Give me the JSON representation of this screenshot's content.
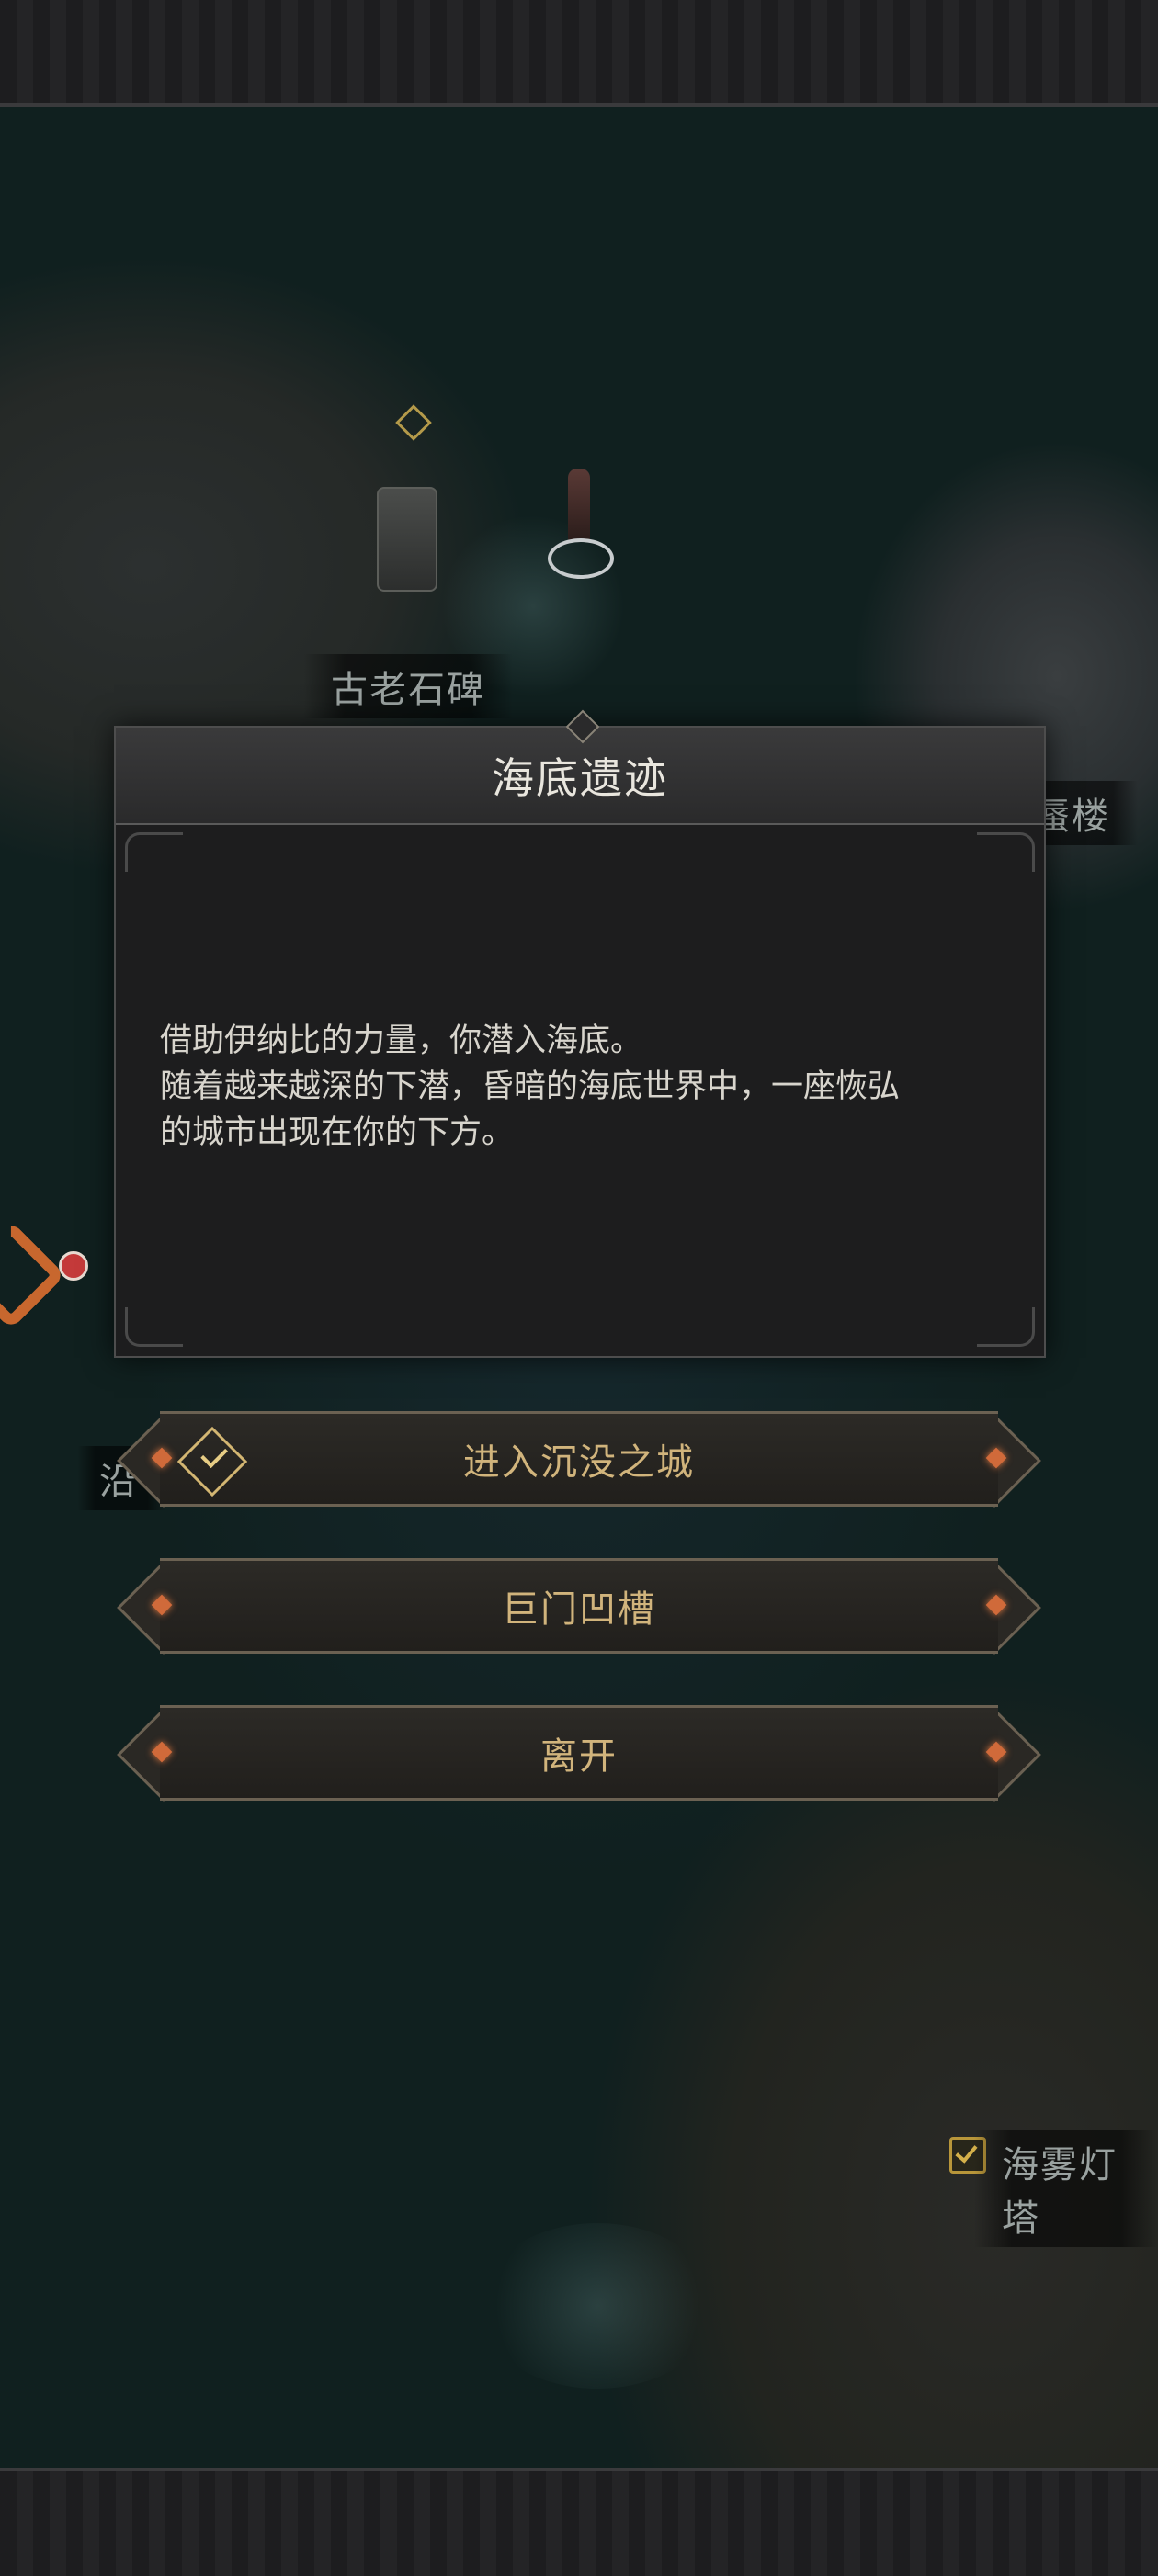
{
  "map": {
    "labels": {
      "ancient_stele": "古老石碑",
      "right_partial": "蜃楼",
      "left_partial": "沿",
      "lighthouse": "海雾灯塔"
    }
  },
  "dialog": {
    "title": "海底遗迹",
    "body": [
      "借助伊纳比的力量，你潜入海底。",
      "随着越来越深的下潜，昏暗的海底世界中，一座恢弘",
      "的城市出现在你的下方。"
    ]
  },
  "choices": [
    {
      "label": "进入沉没之城",
      "completed": true
    },
    {
      "label": "巨门凹槽",
      "completed": false
    },
    {
      "label": "离开",
      "completed": false
    }
  ],
  "colors": {
    "accent_gold": "#d1b47c",
    "gem_orange": "#d06a3a",
    "dialog_bg": "#1d1d1e"
  }
}
